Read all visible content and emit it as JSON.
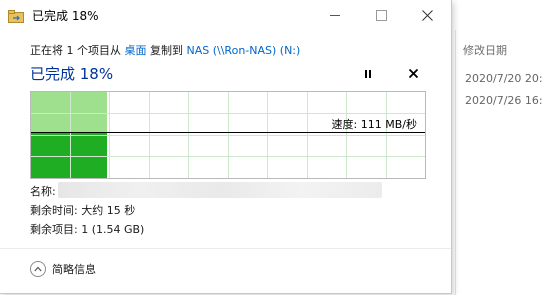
{
  "background": {
    "column_header": "修改日期",
    "rows": [
      "2020/7/20 20:",
      "2020/7/26 16:"
    ]
  },
  "dialog": {
    "title": "已完成 18%",
    "copy_prefix": "正在将 1 个项目从 ",
    "source": "桌面",
    "copy_middle": " 复制到 ",
    "destination": "NAS (\\\\Ron-NAS) (N:)",
    "progress_heading": "已完成 18%",
    "progress_percent": 18,
    "speed_label": "速度: 111 MB/秒",
    "name_label": "名称:",
    "time_remaining": "剩余时间: 大约 15 秒",
    "items_remaining": "剩余项目: 1 (1.54 GB)",
    "details_toggle": "简略信息"
  },
  "colors": {
    "link": "#0066cc",
    "heading": "#003399",
    "graph_fill_light": "#9fe08f",
    "graph_fill_dark": "#1fad24",
    "grid": "#cde8cd"
  },
  "icons": {
    "app": "copy-icon",
    "pause": "pause-icon",
    "stop": "close-icon",
    "details": "chevron-up-icon"
  }
}
